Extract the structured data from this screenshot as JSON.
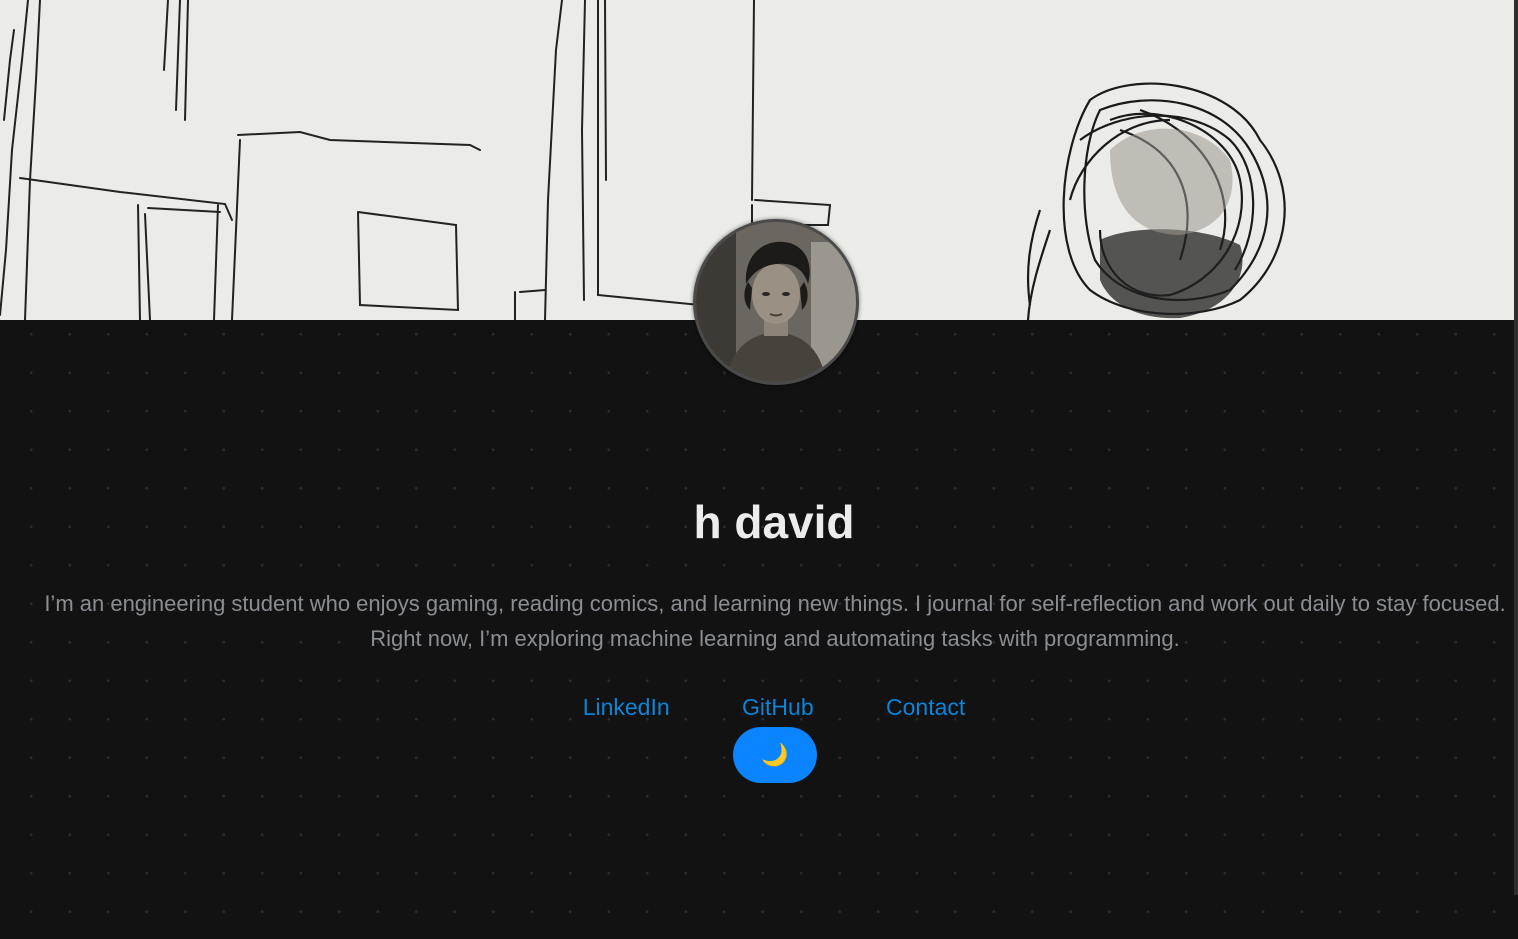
{
  "profile": {
    "name": "h david",
    "bio": "I’m an engineering student who enjoys gaming, reading comics, and learning new things. I journal for self-reflection and work out daily to stay focused. Right now, I’m exploring machine learning and automating tasks with programming."
  },
  "links": [
    {
      "label": "LinkedIn"
    },
    {
      "label": "GitHub"
    },
    {
      "label": "Contact"
    }
  ],
  "theme_toggle": {
    "icon": "moon-icon",
    "glyph": "🌙"
  },
  "colors": {
    "background": "#121212",
    "link": "#0d84d8",
    "toggle": "#0a84ff",
    "name": "#ececec",
    "bio": "#8a8d92"
  }
}
